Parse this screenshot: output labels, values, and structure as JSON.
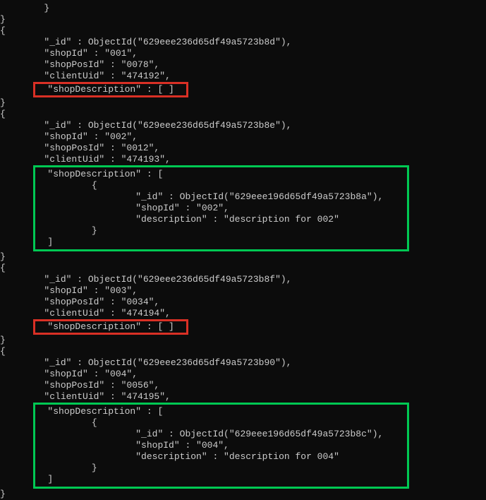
{
  "records": [
    {
      "closeBefore": "}",
      "openBefore": "{",
      "fields": {
        "id": "        \"_id\" : ObjectId(\"629eee236d65df49a5723b8d\"),",
        "shopId": "        \"shopId\" : \"001\",",
        "shopPosId": "        \"shopPosId\" : \"0078\",",
        "clientUid": "        \"clientUid\" : \"474192\","
      },
      "highlightType": "red",
      "highlightContent": "  \"shopDescription\" : [ ]  ",
      "closeAfter": "}",
      "openAfter": "{"
    },
    {
      "closeBefore": null,
      "openBefore": null,
      "fields": {
        "id": "        \"_id\" : ObjectId(\"629eee236d65df49a5723b8e\"),",
        "shopId": "        \"shopId\" : \"002\",",
        "shopPosId": "        \"shopPosId\" : \"0012\",",
        "clientUid": "        \"clientUid\" : \"474193\","
      },
      "highlightType": "green",
      "highlightLines": [
        "  \"shopDescription\" : [                                          ",
        "          {                                                        ",
        "                  \"_id\" : ObjectId(\"629eee196d65df49a5723b8a\"),   ",
        "                  \"shopId\" : \"002\",                               ",
        "                  \"description\" : \"description for 002\"           ",
        "          }                                                        ",
        "  ]                                                                "
      ],
      "closeAfter": "}",
      "openAfter": "{"
    },
    {
      "closeBefore": null,
      "openBefore": null,
      "fields": {
        "id": "        \"_id\" : ObjectId(\"629eee236d65df49a5723b8f\"),",
        "shopId": "        \"shopId\" : \"003\",",
        "shopPosId": "        \"shopPosId\" : \"0034\",",
        "clientUid": "        \"clientUid\" : \"474194\","
      },
      "highlightType": "red",
      "highlightContent": "  \"shopDescription\" : [ ]  ",
      "closeAfter": "}",
      "openAfter": "{"
    },
    {
      "closeBefore": null,
      "openBefore": null,
      "fields": {
        "id": "        \"_id\" : ObjectId(\"629eee236d65df49a5723b90\"),",
        "shopId": "        \"shopId\" : \"004\",",
        "shopPosId": "        \"shopPosId\" : \"0056\",",
        "clientUid": "        \"clientUid\" : \"474195\","
      },
      "highlightType": "green",
      "highlightLines": [
        "  \"shopDescription\" : [                                          ",
        "          {                                                        ",
        "                  \"_id\" : ObjectId(\"629eee196d65df49a5723b8c\"),   ",
        "                  \"shopId\" : \"004\",                               ",
        "                  \"description\" : \"description for 004\"           ",
        "          }                                                        ",
        "  ]                                                                "
      ],
      "closeAfter": "}",
      "openAfter": null
    }
  ],
  "topFragment": "        }"
}
